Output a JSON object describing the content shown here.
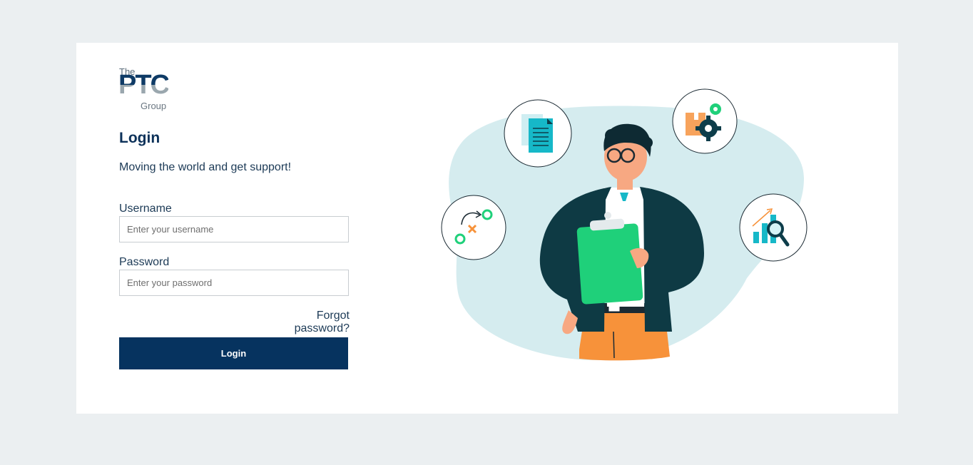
{
  "brand": {
    "the": "The",
    "ptc": "PTC",
    "group": "Group"
  },
  "login": {
    "title": "Login",
    "subtitle": "Moving the world and get support!",
    "username_label": "Username",
    "username_placeholder": "Enter your username",
    "username_value": "",
    "password_label": "Password",
    "password_placeholder": "Enter your password",
    "password_value": "",
    "forgot_label": "Forgot password?",
    "button_label": "Login"
  },
  "illustration": {
    "icons": [
      "document-icon",
      "gears-icon",
      "strategy-icon",
      "analytics-icon"
    ]
  },
  "colors": {
    "page_bg": "#ebeff1",
    "card_bg": "#ffffff",
    "primary": "#06335f",
    "title": "#0c3159",
    "accent_teal": "#16b8c8",
    "accent_green": "#1fd07a",
    "accent_orange": "#f7923a",
    "blob": "#d5ecef"
  }
}
